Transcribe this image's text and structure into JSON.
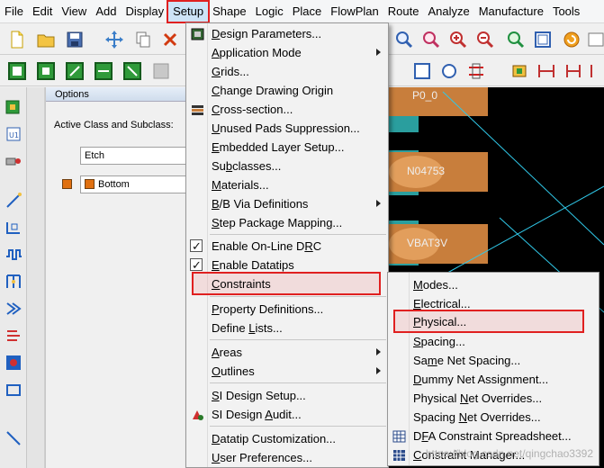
{
  "menubar": {
    "items": [
      "File",
      "Edit",
      "View",
      "Add",
      "Display",
      "Setup",
      "Shape",
      "Logic",
      "Place",
      "FlowPlan",
      "Route",
      "Analyze",
      "Manufacture",
      "Tools"
    ]
  },
  "options": {
    "title": "Options",
    "active_label": "Active Class and Subclass:",
    "class_value": "Etch",
    "subclass_value": "Bottom"
  },
  "canvas": {
    "labels": [
      "P0_0",
      "N04753",
      "VBAT3V"
    ]
  },
  "setup_menu": {
    "items": [
      {
        "label": "Design Parameters...",
        "underline": "D"
      },
      {
        "label": "Application Mode",
        "underline": "A"
      },
      {
        "label": "Grids...",
        "underline": "G"
      },
      {
        "label": "Change Drawing Origin",
        "underline": "C"
      },
      {
        "label": "Cross-section...",
        "underline": "C"
      },
      {
        "label": "Unused Pads Suppression...",
        "underline": "U"
      },
      {
        "label": "Embedded Layer Setup...",
        "underline": "E"
      },
      {
        "label": "Subclasses...",
        "underline": "b"
      },
      {
        "label": "Materials...",
        "underline": "M"
      },
      {
        "label": "B/B Via Definitions",
        "underline": "B"
      },
      {
        "label": "Step Package Mapping...",
        "underline": "S"
      },
      {
        "label": "Enable On-Line DRC",
        "underline": "R"
      },
      {
        "label": "Enable Datatips",
        "underline": "E"
      },
      {
        "label": "Constraints",
        "underline": "C"
      },
      {
        "label": "Property Definitions...",
        "underline": "P"
      },
      {
        "label": "Define Lists...",
        "underline": "L"
      },
      {
        "label": "Areas",
        "underline": "A"
      },
      {
        "label": "Outlines",
        "underline": "O"
      },
      {
        "label": "SI Design Setup...",
        "underline": "S"
      },
      {
        "label": "SI Design Audit...",
        "underline": "A"
      },
      {
        "label": "Datatip Customization...",
        "underline": "D"
      },
      {
        "label": "User Preferences...",
        "underline": "U"
      }
    ]
  },
  "constraints_submenu": {
    "items": [
      {
        "label": "Modes...",
        "underline": "M"
      },
      {
        "label": "Electrical...",
        "underline": "E"
      },
      {
        "label": "Physical...",
        "underline": "P"
      },
      {
        "label": "Spacing...",
        "underline": "S"
      },
      {
        "label": "Same Net Spacing...",
        "underline": "m"
      },
      {
        "label": "Dummy Net Assignment...",
        "underline": "D"
      },
      {
        "label": "Physical Net Overrides...",
        "underline": "N"
      },
      {
        "label": "Spacing Net Overrides...",
        "underline": "N"
      },
      {
        "label": "DFA Constraint Spreadsheet...",
        "underline": "F"
      },
      {
        "label": "Constraint Manager...",
        "underline": "C"
      }
    ]
  },
  "watermark": "https://blog.csdn.net/qingchao3392"
}
